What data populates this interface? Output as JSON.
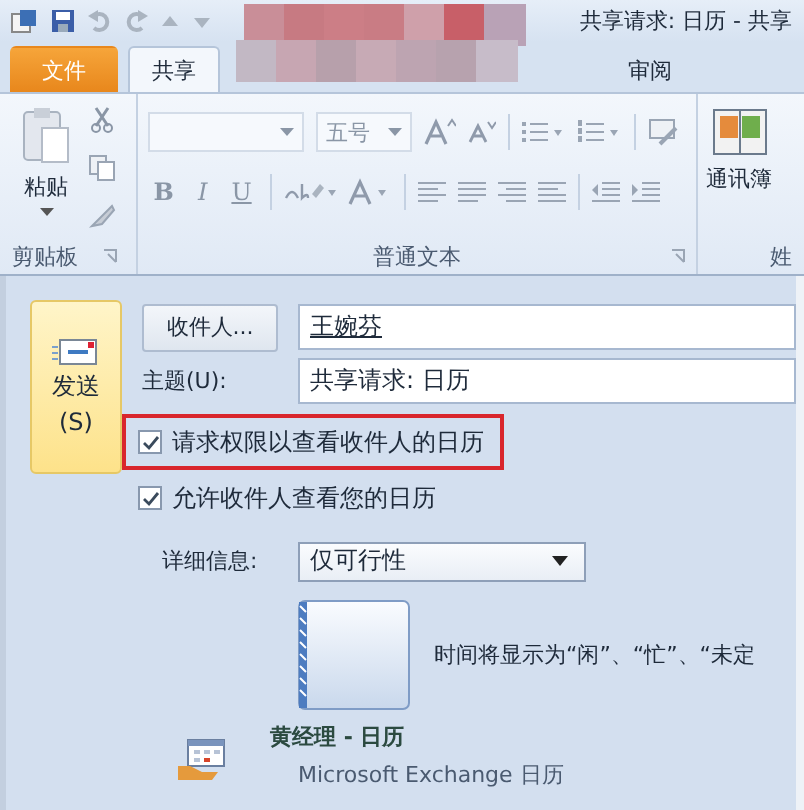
{
  "window": {
    "title": "共享请求: 日历 - 共享"
  },
  "tabs": [
    {
      "label": "文件",
      "kind": "file",
      "selected": false
    },
    {
      "label": "共享",
      "kind": "tab",
      "selected": true
    },
    {
      "label": "审阅",
      "kind": "tab",
      "selected": false
    }
  ],
  "ribbon": {
    "clipboard": {
      "paste": "粘贴",
      "label": "剪贴板"
    },
    "text": {
      "font_size": "五号",
      "format_buttons": [
        "B",
        "I",
        "U"
      ],
      "label": "普通文本"
    },
    "names": {
      "address_book": "通讯簿",
      "label": "姓"
    }
  },
  "send": {
    "label": "发送",
    "shortcut": "(S)"
  },
  "to": {
    "button": "收件人...",
    "value": "王婉芬"
  },
  "subject": {
    "label": "主题(U):",
    "value": "共享请求: 日历"
  },
  "options": [
    {
      "label": "请求权限以查看收件人的日历",
      "checked": true,
      "highlighted": true
    },
    {
      "label": "允许收件人查看您的日历",
      "checked": true,
      "highlighted": false
    }
  ],
  "details": {
    "label": "详细信息:",
    "value": "仅可行性"
  },
  "preview_note": "时间将显示为“闲”、“忙”、“未定",
  "calendar": {
    "title": "黄经理 - 日历",
    "subtitle": "Microsoft Exchange 日历"
  }
}
